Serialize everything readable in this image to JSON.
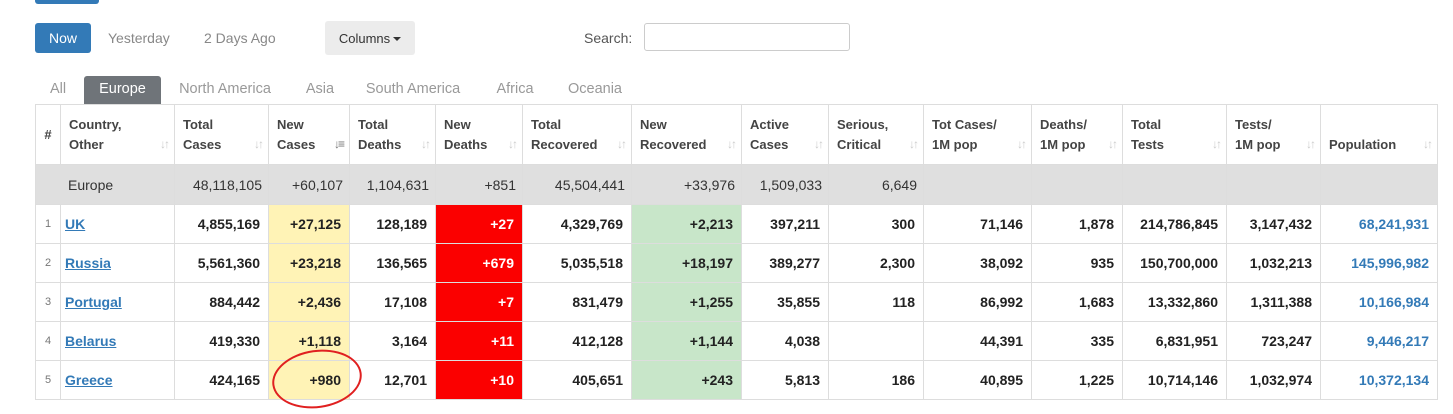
{
  "toolbar": {
    "now": "Now",
    "yesterday": "Yesterday",
    "two_days_ago": "2 Days Ago",
    "columns": "Columns",
    "search_label": "Search:",
    "search_value": ""
  },
  "tabs": [
    "All",
    "Europe",
    "North America",
    "Asia",
    "South America",
    "Africa",
    "Oceania"
  ],
  "active_tab": "Europe",
  "headers": {
    "num": "#",
    "country": [
      "Country,",
      "Other"
    ],
    "total_cases": [
      "Total",
      "Cases"
    ],
    "new_cases": [
      "New",
      "Cases"
    ],
    "total_deaths": [
      "Total",
      "Deaths"
    ],
    "new_deaths": [
      "New",
      "Deaths"
    ],
    "total_recovered": [
      "Total",
      "Recovered"
    ],
    "new_recovered": [
      "New",
      "Recovered"
    ],
    "active_cases": [
      "Active",
      "Cases"
    ],
    "serious": [
      "Serious,",
      "Critical"
    ],
    "cases_per_m": [
      "Tot Cases/",
      "1M pop"
    ],
    "deaths_per_m": [
      "Deaths/",
      "1M pop"
    ],
    "total_tests": [
      "Total",
      "Tests"
    ],
    "tests_per_m": [
      "Tests/",
      "1M pop"
    ],
    "population": [
      "",
      "Population"
    ]
  },
  "total_row": {
    "name": "Europe",
    "total_cases": "48,118,105",
    "new_cases": "+60,107",
    "total_deaths": "1,104,631",
    "new_deaths": "+851",
    "total_recovered": "45,504,441",
    "new_recovered": "+33,976",
    "active_cases": "1,509,033",
    "serious": "6,649"
  },
  "rows": [
    {
      "rank": "1",
      "country": "UK",
      "total_cases": "4,855,169",
      "new_cases": "+27,125",
      "total_deaths": "128,189",
      "new_deaths": "+27",
      "total_recovered": "4,329,769",
      "new_recovered": "+2,213",
      "active_cases": "397,211",
      "serious": "300",
      "cases_per_m": "71,146",
      "deaths_per_m": "1,878",
      "total_tests": "214,786,845",
      "tests_per_m": "3,147,432",
      "population": "68,241,931"
    },
    {
      "rank": "2",
      "country": "Russia",
      "total_cases": "5,561,360",
      "new_cases": "+23,218",
      "total_deaths": "136,565",
      "new_deaths": "+679",
      "total_recovered": "5,035,518",
      "new_recovered": "+18,197",
      "active_cases": "389,277",
      "serious": "2,300",
      "cases_per_m": "38,092",
      "deaths_per_m": "935",
      "total_tests": "150,700,000",
      "tests_per_m": "1,032,213",
      "population": "145,996,982"
    },
    {
      "rank": "3",
      "country": "Portugal",
      "total_cases": "884,442",
      "new_cases": "+2,436",
      "total_deaths": "17,108",
      "new_deaths": "+7",
      "total_recovered": "831,479",
      "new_recovered": "+1,255",
      "active_cases": "35,855",
      "serious": "118",
      "cases_per_m": "86,992",
      "deaths_per_m": "1,683",
      "total_tests": "13,332,860",
      "tests_per_m": "1,311,388",
      "population": "10,166,984"
    },
    {
      "rank": "4",
      "country": "Belarus",
      "total_cases": "419,330",
      "new_cases": "+1,118",
      "total_deaths": "3,164",
      "new_deaths": "+11",
      "total_recovered": "412,128",
      "new_recovered": "+1,144",
      "active_cases": "4,038",
      "serious": "",
      "cases_per_m": "44,391",
      "deaths_per_m": "335",
      "total_tests": "6,831,951",
      "tests_per_m": "723,247",
      "population": "9,446,217"
    },
    {
      "rank": "5",
      "country": "Greece",
      "total_cases": "424,165",
      "new_cases": "+980",
      "total_deaths": "12,701",
      "new_deaths": "+10",
      "total_recovered": "405,651",
      "new_recovered": "+243",
      "active_cases": "5,813",
      "serious": "186",
      "cases_per_m": "40,895",
      "deaths_per_m": "1,225",
      "total_tests": "10,714,146",
      "tests_per_m": "1,032,974",
      "population": "10,372,134"
    }
  ],
  "colors": {
    "accent": "#337ab7",
    "new_cases_bg": "#fff3b6",
    "new_deaths_bg": "#fb0000",
    "new_recovered_bg": "#c8e6c9",
    "annotation_circle": "#e02020"
  }
}
